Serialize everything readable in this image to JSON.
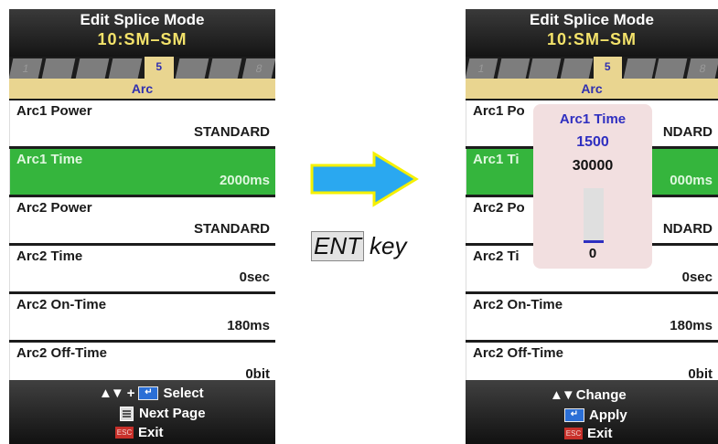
{
  "left_screen": {
    "title": "Edit Splice Mode",
    "subtitle": "10:SM–SM",
    "tabs": [
      "1",
      "",
      "",
      "",
      "5",
      "",
      "",
      "",
      "8"
    ],
    "section": "Arc",
    "items": [
      {
        "name": "Arc1 Power",
        "value": "STANDARD"
      },
      {
        "name": "Arc1 Time",
        "value": "2000ms"
      },
      {
        "name": "Arc2 Power",
        "value": "STANDARD"
      },
      {
        "name": "Arc2 Time",
        "value": "0sec"
      },
      {
        "name": "Arc2 On-Time",
        "value": "180ms"
      },
      {
        "name": "Arc2 Off-Time",
        "value": "0bit"
      }
    ],
    "footer": {
      "select": "Select",
      "next_page": "Next Page",
      "exit": "Exit",
      "esc_key": "ESC"
    }
  },
  "transition": {
    "key_name": "ENT",
    "key_suffix": "key",
    "arrow_color": "#2aa8f0",
    "arrow_border": "#f5f000"
  },
  "right_screen": {
    "title": "Edit Splice Mode",
    "subtitle": "10:SM–SM",
    "tabs": [
      "1",
      "",
      "",
      "",
      "5",
      "",
      "",
      "",
      "8"
    ],
    "section": "Arc",
    "items_visible": [
      {
        "name": "Arc1 Po",
        "value": "NDARD"
      },
      {
        "name": "Arc1 Ti",
        "value": "000ms"
      },
      {
        "name": "Arc2 Po",
        "value": "NDARD"
      },
      {
        "name": "Arc2 Ti",
        "value": "0sec"
      },
      {
        "name": "Arc2 On-Time",
        "value": "180ms"
      },
      {
        "name": "Arc2 Off-Time",
        "value": "0bit"
      }
    ],
    "popup": {
      "title": "Arc1 Time",
      "value": "1500",
      "max": "30000",
      "min": "0",
      "level_fraction": 0.05
    },
    "footer": {
      "change": "Change",
      "apply": "Apply",
      "exit": "Exit",
      "esc_key": "ESC"
    }
  },
  "colors": {
    "selected_row": "#35b53d",
    "tab_active": "#e9d590",
    "accent_blue": "#2f2fc0"
  }
}
